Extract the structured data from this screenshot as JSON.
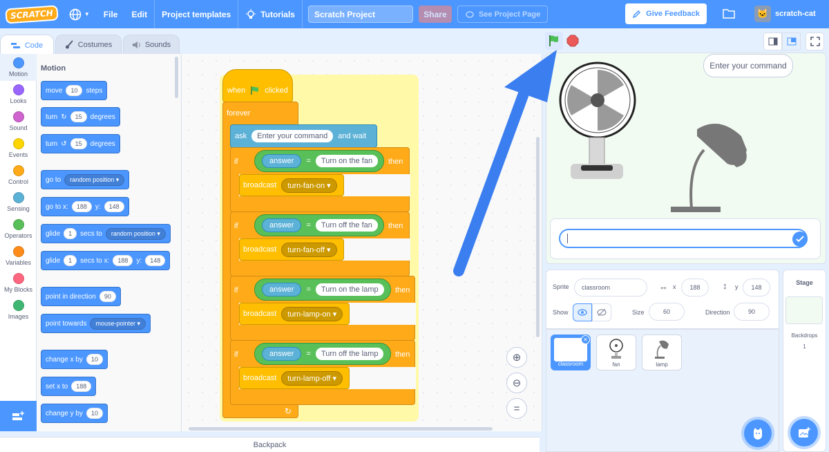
{
  "menu": {
    "logo": "SCRATCH",
    "file": "File",
    "edit": "Edit",
    "project_templates": "Project templates",
    "tutorials": "Tutorials",
    "project_title": "Scratch Project",
    "share": "Share",
    "see_project_page": "See Project Page",
    "give_feedback": "Give Feedback",
    "username": "scratch-cat"
  },
  "tabs": {
    "code": "Code",
    "costumes": "Costumes",
    "sounds": "Sounds"
  },
  "categories": [
    {
      "label": "Motion",
      "color": "#4c97ff"
    },
    {
      "label": "Looks",
      "color": "#9966ff"
    },
    {
      "label": "Sound",
      "color": "#cf63cf"
    },
    {
      "label": "Events",
      "color": "#ffd500"
    },
    {
      "label": "Control",
      "color": "#ffab19"
    },
    {
      "label": "Sensing",
      "color": "#5cb1d6"
    },
    {
      "label": "Operators",
      "color": "#59c059"
    },
    {
      "label": "Variables",
      "color": "#ff8c1a"
    },
    {
      "label": "My Blocks",
      "color": "#ff6680"
    },
    {
      "label": "Images",
      "color": "#3fb772"
    }
  ],
  "palette": {
    "heading": "Motion",
    "move": "move",
    "move_val": "10",
    "steps": "steps",
    "turn": "turn",
    "turn_cw_val": "15",
    "turn_ccw_val": "15",
    "degrees": "degrees",
    "go_to": "go to",
    "random_position": "random position",
    "go_to_xy": "go to x:",
    "x_val": "188",
    "y_lbl": "y:",
    "y_val": "148",
    "glide": "glide",
    "glide_secs": "1",
    "secs_to": "secs to",
    "secs_to_x": "secs to x:",
    "point_in_direction": "point in direction",
    "dir_val": "90",
    "point_towards": "point towards",
    "mouse_pointer": "mouse-pointer",
    "change_x_by": "change x by",
    "change_x_val": "10",
    "set_x_to": "set x to",
    "set_x_val": "188",
    "change_y_by": "change y by",
    "change_y_val": "10"
  },
  "script": {
    "when": "when",
    "clicked": "clicked",
    "forever": "forever",
    "ask": "ask",
    "ask_text": "Enter your command",
    "and_wait": "and wait",
    "if": "if",
    "then": "then",
    "answer": "answer",
    "equals": "=",
    "broadcast": "broadcast",
    "conditions": [
      {
        "value": "Turn on the fan",
        "message": "turn-fan-on"
      },
      {
        "value": "Turn off the fan",
        "message": "turn-fan-off"
      },
      {
        "value": "Turn on the lamp",
        "message": "turn-lamp-on"
      },
      {
        "value": "Turn off the lamp",
        "message": "turn-lamp-off"
      }
    ]
  },
  "backpack": "Backpack",
  "stage": {
    "speech": "Enter your command"
  },
  "sprite_info": {
    "sprite_lbl": "Sprite",
    "sprite_name": "classroom",
    "x_lbl": "x",
    "x": "188",
    "y_lbl": "y",
    "y": "148",
    "show_lbl": "Show",
    "size_lbl": "Size",
    "size": "60",
    "direction_lbl": "Direction",
    "direction": "90"
  },
  "sprites": [
    {
      "name": "classroom",
      "selected": true
    },
    {
      "name": "fan",
      "selected": false
    },
    {
      "name": "lamp",
      "selected": false
    }
  ],
  "stage_panel": {
    "title": "Stage",
    "backdrops_lbl": "Backdrops",
    "backdrops_count": "1"
  }
}
